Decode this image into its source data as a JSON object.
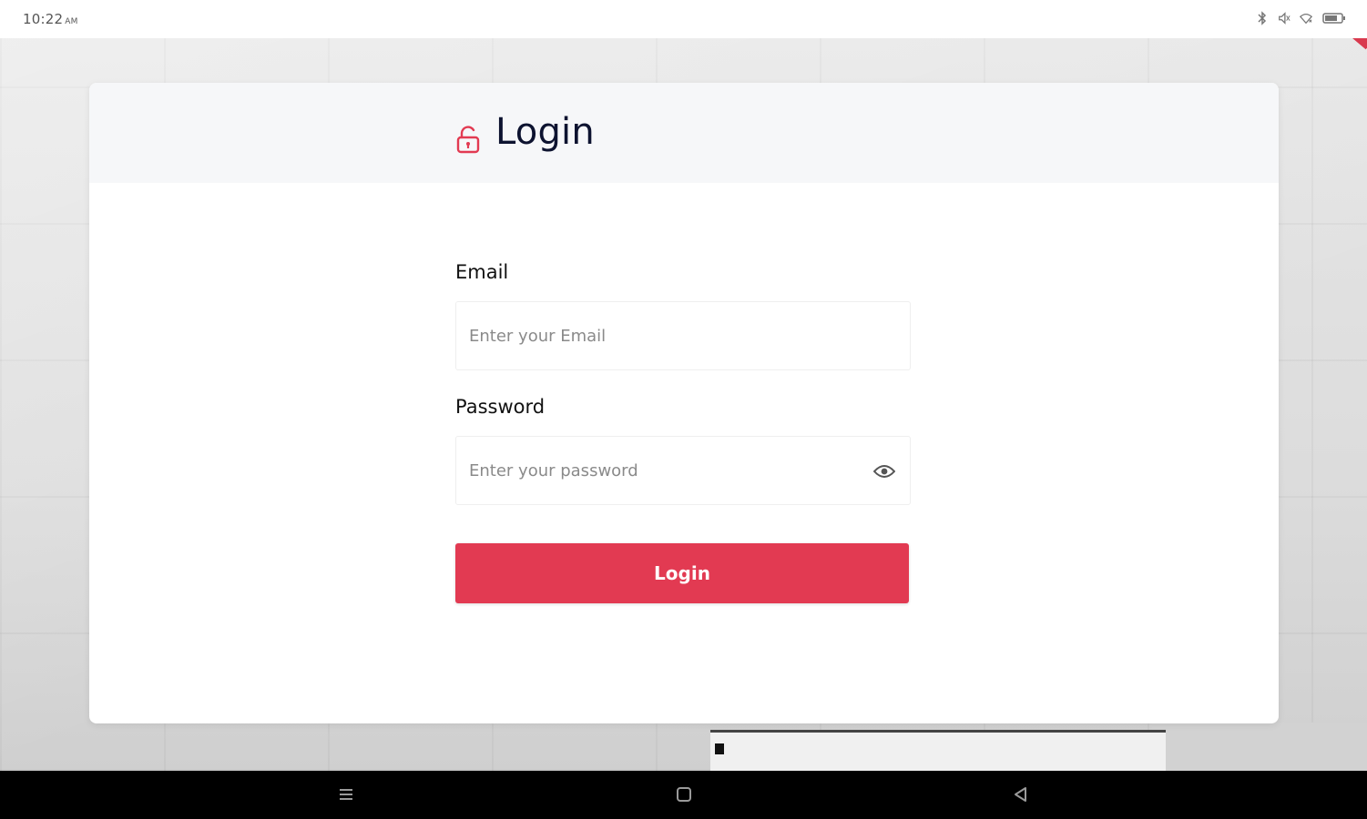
{
  "status_bar": {
    "time": "10:22",
    "ampm": "AM",
    "icons": [
      "bluetooth-icon",
      "volume-icon",
      "wifi-icon",
      "battery-icon"
    ]
  },
  "login_card": {
    "title": "Login",
    "email": {
      "label": "Email",
      "placeholder": "Enter your Email",
      "value": ""
    },
    "password": {
      "label": "Password",
      "placeholder": "Enter your password",
      "value": ""
    },
    "submit_label": "Login"
  },
  "nav_bar": {
    "buttons": [
      "recents-icon",
      "home-icon",
      "back-icon"
    ]
  },
  "colors": {
    "accent": "#e23a52",
    "title": "#0d1330",
    "header_bg": "#f6f7f9"
  }
}
